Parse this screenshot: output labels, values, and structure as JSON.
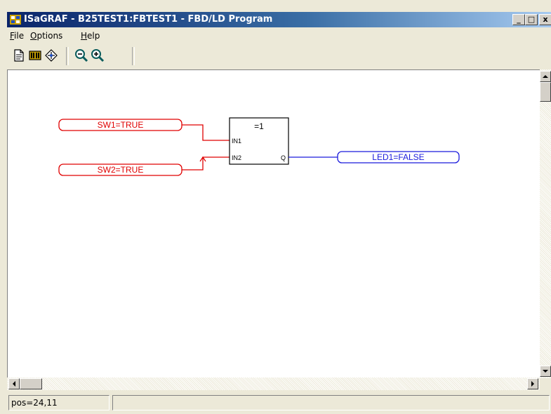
{
  "window": {
    "title": "ISaGRAF - B25TEST1:FBTEST1 - FBD/LD Program",
    "minimize_label": "_",
    "maximize_label": "□",
    "close_label": "x"
  },
  "menu": {
    "items": [
      {
        "label_u": "F",
        "label_rest": "ile"
      },
      {
        "label_u": "O",
        "label_rest": "ptions"
      },
      {
        "label_u": "H",
        "label_rest": "elp"
      }
    ]
  },
  "toolbar": {
    "icons": [
      "document-icon",
      "library-icon",
      "network-icon",
      "zoom-out-icon",
      "zoom-in-icon"
    ]
  },
  "diagram": {
    "inputs": [
      {
        "label": "SW1=TRUE",
        "color": "#e00000"
      },
      {
        "label": "SW2=TRUE",
        "color": "#e00000"
      }
    ],
    "block": {
      "name": "=1",
      "pins_in": [
        "IN1",
        "IN2"
      ],
      "pin_out": "Q"
    },
    "output": {
      "label": "LED1=FALSE",
      "color": "#1a1adc"
    }
  },
  "status": {
    "position": "pos=24,11"
  }
}
